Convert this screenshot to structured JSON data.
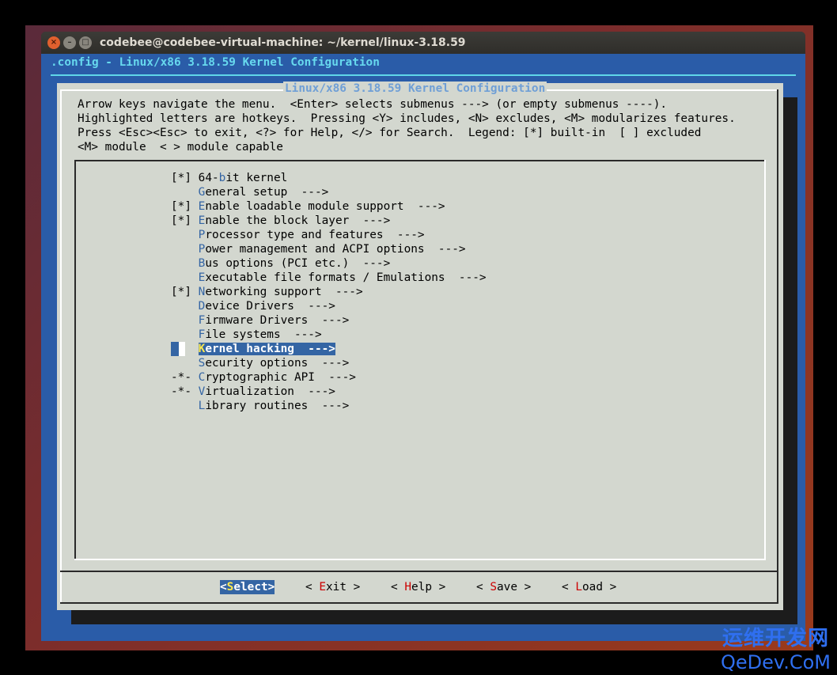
{
  "window": {
    "title": "codebee@codebee-virtual-machine: ~/kernel/linux-3.18.59",
    "close_glyph": "×",
    "min_glyph": "–",
    "max_glyph": "□"
  },
  "terminal": {
    "header": ".config - Linux/x86 3.18.59 Kernel Configuration"
  },
  "dialog": {
    "title": "Linux/x86 3.18.59 Kernel Configuration",
    "help_lines": [
      "Arrow keys navigate the menu.  <Enter> selects submenus ---> (or empty submenus ----).",
      "Highlighted letters are hotkeys.  Pressing <Y> includes, <N> excludes, <M> modularizes features.",
      "Press <Esc><Esc> to exit, <?> for Help, </> for Search.  Legend: [*] built-in  [ ] excluded",
      "<M> module  < > module capable"
    ]
  },
  "menu": {
    "items": [
      {
        "prefix": "[*] ",
        "pre": "64-",
        "hotkey": "b",
        "rest": "it kernel",
        "suffix": ""
      },
      {
        "prefix": "    ",
        "pre": "",
        "hotkey": "G",
        "rest": "eneral setup",
        "suffix": "  --->"
      },
      {
        "prefix": "[*] ",
        "pre": "",
        "hotkey": "E",
        "rest": "nable loadable module support",
        "suffix": "  --->"
      },
      {
        "prefix": "[*] ",
        "pre": "",
        "hotkey": "E",
        "rest": "nable the block layer",
        "suffix": "  --->"
      },
      {
        "prefix": "    ",
        "pre": "",
        "hotkey": "P",
        "rest": "rocessor type and features",
        "suffix": "  --->"
      },
      {
        "prefix": "    ",
        "pre": "",
        "hotkey": "P",
        "rest": "ower management and ACPI options",
        "suffix": "  --->"
      },
      {
        "prefix": "    ",
        "pre": "",
        "hotkey": "B",
        "rest": "us options (PCI etc.)",
        "suffix": "  --->"
      },
      {
        "prefix": "    ",
        "pre": "",
        "hotkey": "E",
        "rest": "xecutable file formats / Emulations",
        "suffix": "  --->"
      },
      {
        "prefix": "[*] ",
        "pre": "",
        "hotkey": "N",
        "rest": "etworking support",
        "suffix": "  --->"
      },
      {
        "prefix": "    ",
        "pre": "",
        "hotkey": "D",
        "rest": "evice Drivers",
        "suffix": "  --->"
      },
      {
        "prefix": "    ",
        "pre": "",
        "hotkey": "F",
        "rest": "irmware Drivers",
        "suffix": "  --->"
      },
      {
        "prefix": "    ",
        "pre": "",
        "hotkey": "F",
        "rest": "ile systems",
        "suffix": "  --->"
      },
      {
        "prefix": "",
        "pre": "",
        "hotkey": "K",
        "rest": "ernel hacking",
        "suffix": "  --->",
        "selected": true
      },
      {
        "prefix": "    ",
        "pre": "",
        "hotkey": "S",
        "rest": "ecurity options",
        "suffix": "  --->"
      },
      {
        "prefix": "-*- ",
        "pre": "",
        "hotkey": "C",
        "rest": "ryptographic API",
        "suffix": "  --->"
      },
      {
        "prefix": "-*- ",
        "pre": "",
        "hotkey": "V",
        "rest": "irtualization",
        "suffix": "  --->"
      },
      {
        "prefix": "    ",
        "pre": "",
        "hotkey": "L",
        "rest": "ibrary routines",
        "suffix": "  --->"
      }
    ]
  },
  "buttons": [
    {
      "open": "<",
      "hotkey": "S",
      "rest": "elect",
      "close": ">",
      "active": true
    },
    {
      "open": "< ",
      "hotkey": "E",
      "rest": "xit",
      "close": " >"
    },
    {
      "open": "< ",
      "hotkey": "H",
      "rest": "elp",
      "close": " >"
    },
    {
      "open": "< ",
      "hotkey": "S",
      "rest": "ave",
      "close": " >"
    },
    {
      "open": "< ",
      "hotkey": "L",
      "rest": "oad",
      "close": " >"
    }
  ],
  "watermark": {
    "line1": "运维开发网",
    "line2": "QeDev.CoM"
  },
  "colors": {
    "terminal_bg": "#2a5ca8",
    "dialog_bg": "#d3d7cf",
    "hotkey_menu": "#3465a4",
    "hotkey_button": "#cc0000",
    "selection": "#3465a4",
    "selection_hotkey": "#fce94f",
    "header_cyan": "#67d9ee"
  }
}
